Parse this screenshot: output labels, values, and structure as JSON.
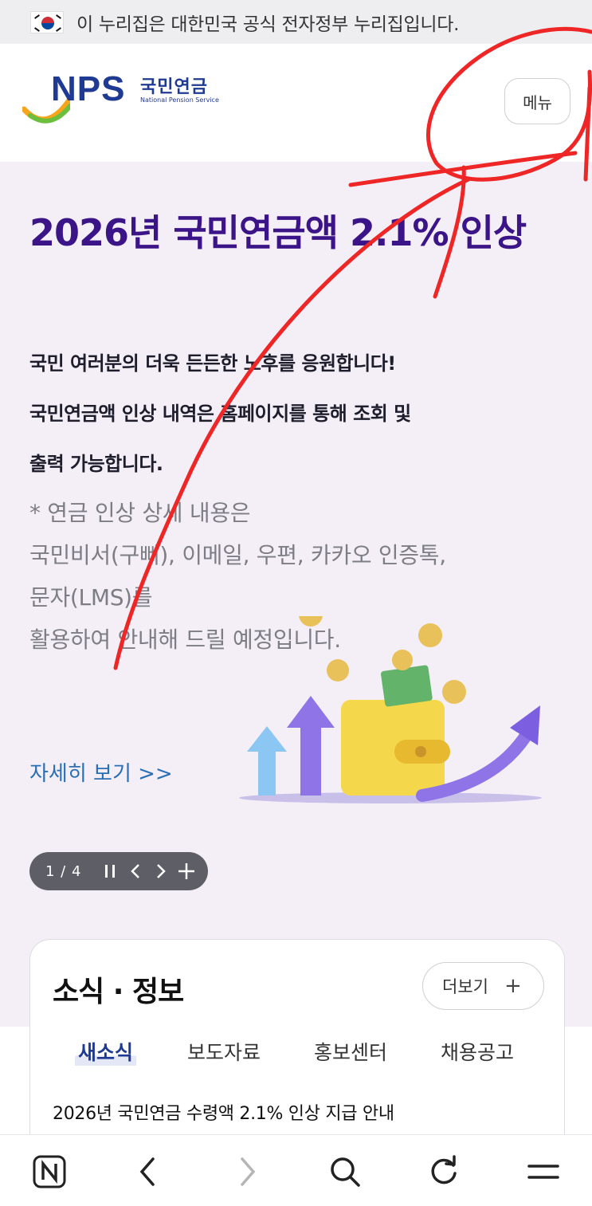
{
  "gov_banner": {
    "text": "이 누리집은 대한민국 공식 전자정부 누리집입니다."
  },
  "header": {
    "logo_main": "NPS",
    "logo_korean": "국민연금",
    "logo_english": "National Pension Service",
    "menu_label": "메뉴"
  },
  "hero": {
    "title": "2026년 국민연금액 2.1% 인상",
    "subtitle_lines": [
      "국민 여러분의 더욱 든든한 노후를 응원합니다!",
      "국민연금액 인상 내역은 홈페이지를 통해 조회 및",
      "출력 가능합니다."
    ],
    "note_lines": [
      "* 연금 인상 상세 내용은",
      "국민비서(구삐), 이메일, 우편, 카카오 인증톡,",
      "문자(LMS)를",
      "활용하여 안내해 드릴 예정입니다."
    ],
    "more_link": "자세히 보기 >>",
    "slide_counter": "1 / 4"
  },
  "news": {
    "title": "소식 · 정보",
    "more_label": "더보기",
    "tabs": [
      "새소식",
      "보도자료",
      "홍보센터",
      "채용공고"
    ],
    "active_tab": "새소식",
    "first_item": "2026년 국민연금 수령액 2.1% 인상 지급 안내"
  },
  "colors": {
    "brand_navy": "#1f3a93",
    "hero_title": "#3b1487",
    "hero_bg": "#f4eff7",
    "link_blue": "#2a6fb4",
    "annotation_red": "#ef2626"
  },
  "icons": {
    "bottom_bar": [
      "naver-n-icon",
      "back-icon",
      "forward-icon",
      "search-icon",
      "refresh-icon",
      "menu-icon"
    ]
  }
}
